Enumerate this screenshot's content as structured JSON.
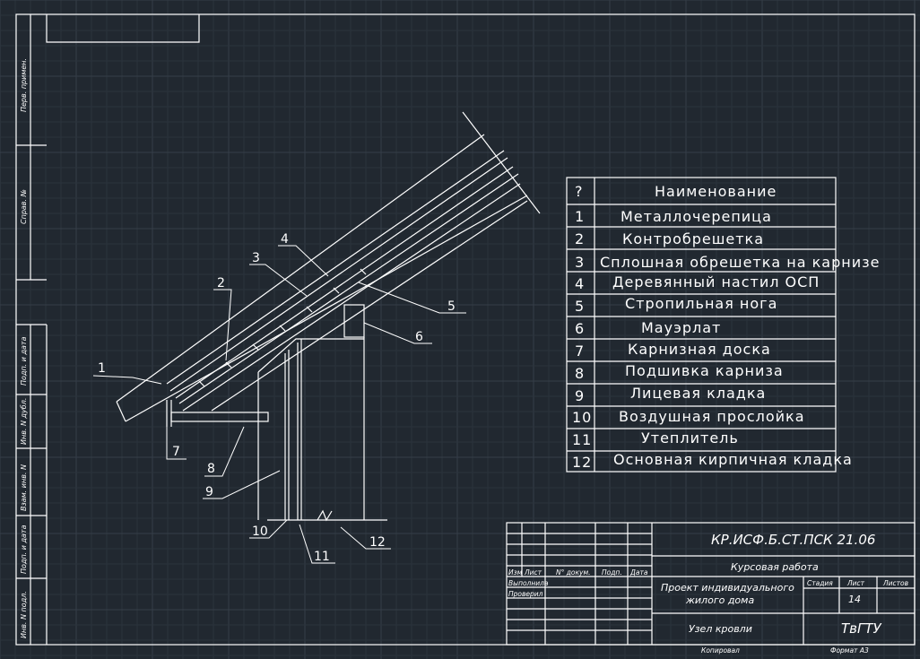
{
  "callouts": [
    "1",
    "2",
    "3",
    "4",
    "5",
    "6",
    "7",
    "8",
    "9",
    "10",
    "11",
    "12"
  ],
  "specification": {
    "header": {
      "number": "?",
      "name": "Наименование"
    },
    "rows": [
      {
        "number": "1",
        "name": "Металлочерепица"
      },
      {
        "number": "2",
        "name": "Контробрешетка"
      },
      {
        "number": "3",
        "name": "Сплошная обрешетка на карнизе"
      },
      {
        "number": "4",
        "name": "Деревянный настил ОСП"
      },
      {
        "number": "5",
        "name": "Стропильная нога"
      },
      {
        "number": "6",
        "name": "Мауэрлат"
      },
      {
        "number": "7",
        "name": "Карнизная доска"
      },
      {
        "number": "8",
        "name": "Подшивка карниза"
      },
      {
        "number": "9",
        "name": "Лицевая кладка"
      },
      {
        "number": "10",
        "name": "Воздушная прослойка"
      },
      {
        "number": "11",
        "name": "Утеплитель"
      },
      {
        "number": "12",
        "name": "Основная кирпичная кладка"
      }
    ]
  },
  "side_stamps": {
    "perv_primen": "Перв. примен.",
    "sprav_no": "Справ. №",
    "podp_data_1": "Подп. и дата",
    "inv_dubl": "Инв. N дубл.",
    "vzam_inv": "Взам. инв. N",
    "podp_data_2": "Подп. и дата",
    "inv_podl": "Инв. N подл."
  },
  "title_block": {
    "code": "КР.ИСФ.Б.СТ.ПСК 21.06",
    "work_type": "Курсовая работа",
    "project_line1": "Проект индивидуального",
    "project_line2": "жилого дома",
    "sheet_title": "Узел кровли",
    "org": "ТвГТУ",
    "col_izm": "Изм",
    "col_list": "Лист",
    "col_doc": "N° докум.",
    "col_podp": "Подп.",
    "col_data": "Дата",
    "row_vypolnil": "Выполнила",
    "row_proveril": "Проверил",
    "stadiya_label": "Стадия",
    "list_label": "Лист",
    "listov_label": "Листов",
    "list_value": "14",
    "copied": "Копировал",
    "format": "Формат А3"
  },
  "colors": {
    "background": "#212830",
    "grid_minor": "#2b333c",
    "grid_major": "#353e48",
    "lines": "#ffffff"
  }
}
